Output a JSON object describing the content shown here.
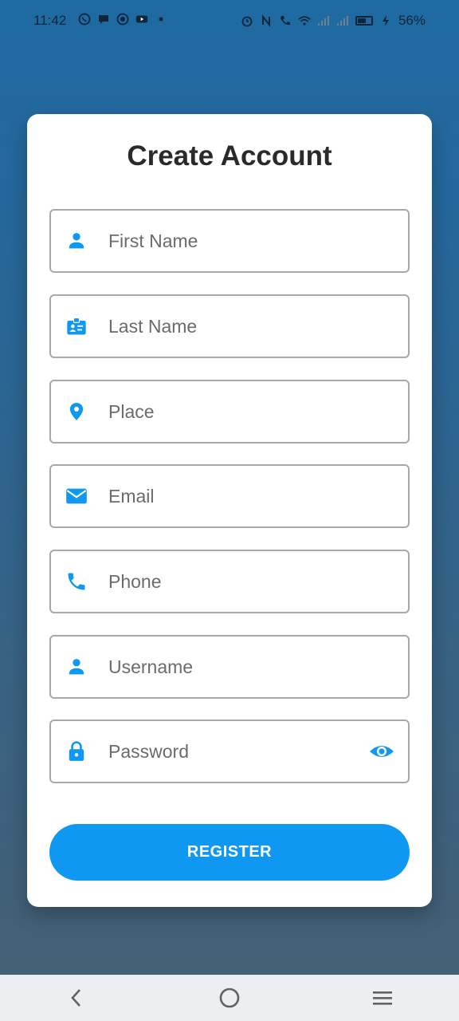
{
  "status_bar": {
    "time": "11:42",
    "battery": "56%",
    "left_icons": [
      "whatsapp-icon",
      "chat-icon",
      "github-icon",
      "youtube-icon",
      "dot-icon"
    ],
    "right_icons": [
      "alarm-icon",
      "nfc-icon",
      "wifi-call-icon",
      "wifi-icon",
      "signal-icon",
      "signal-icon",
      "battery-icon",
      "charging-icon"
    ]
  },
  "form": {
    "title": "Create Account",
    "fields": [
      {
        "placeholder": "First Name",
        "icon": "person-icon"
      },
      {
        "placeholder": "Last Name",
        "icon": "badge-icon"
      },
      {
        "placeholder": "Place",
        "icon": "location-pin-icon"
      },
      {
        "placeholder": "Email",
        "icon": "mail-icon"
      },
      {
        "placeholder": "Phone",
        "icon": "phone-icon"
      },
      {
        "placeholder": "Username",
        "icon": "person-icon"
      },
      {
        "placeholder": "Password",
        "icon": "lock-icon"
      }
    ],
    "register_label": "REGISTER"
  },
  "nav": {
    "buttons": [
      "back-icon",
      "home-icon",
      "recents-icon"
    ]
  },
  "colors": {
    "accent": "#0f98f2",
    "card": "#ffffff",
    "background_top": "#1f6aa3",
    "background_bottom": "#455f73"
  }
}
